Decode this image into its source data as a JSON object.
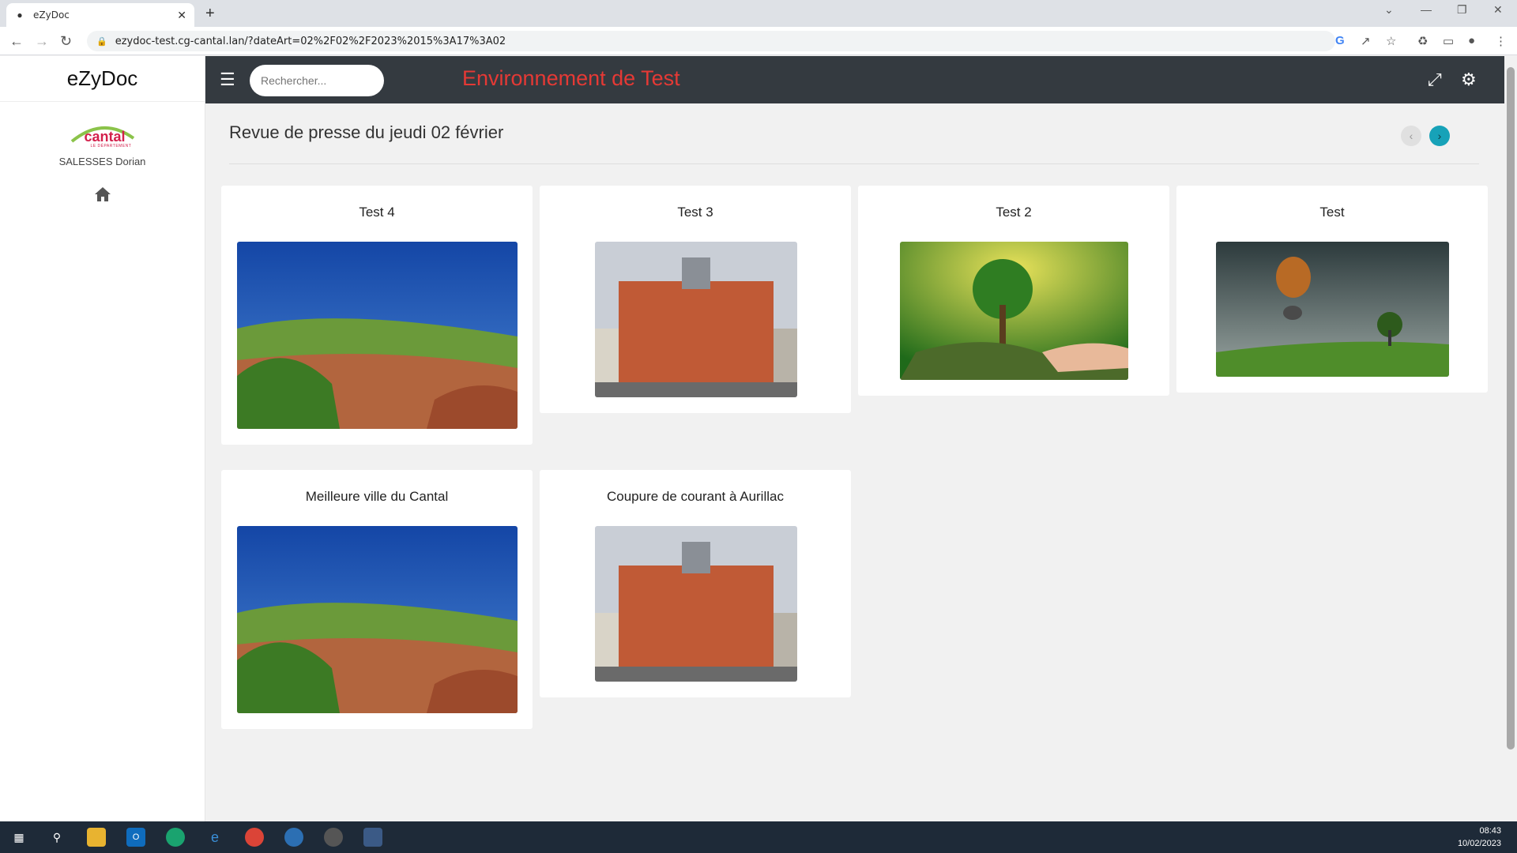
{
  "browser": {
    "tab_title": "eZyDoc",
    "url": "ezydoc-test.cg-cantal.lan/?dateArt=02%2F02%2F2023%2015%3A17%3A02"
  },
  "sidebar": {
    "brand": "eZyDoc",
    "logo_text": "cantal",
    "logo_subtext": "LE DÉPARTEMENT",
    "username": "SALESSES Dorian"
  },
  "topbar": {
    "search_placeholder": "Rechercher...",
    "env_title": "Environnement de Test"
  },
  "main": {
    "page_title": "Revue de presse du jeudi 02 février",
    "cards": [
      {
        "title": "Test 4",
        "image": "landscape-town"
      },
      {
        "title": "Test 3",
        "image": "town-hall"
      },
      {
        "title": "Test 2",
        "image": "tree-in-hand"
      },
      {
        "title": "Test",
        "image": "balloon-elephant"
      },
      {
        "title": "Meilleure ville du Cantal",
        "image": "landscape-town"
      },
      {
        "title": "Coupure de courant à Aurillac",
        "image": "town-hall"
      }
    ]
  },
  "taskbar": {
    "time": "08:43",
    "date": "10/02/2023"
  },
  "colors": {
    "topbar": "#343a40",
    "env_title": "#e53935",
    "accent": "#17a2b8"
  }
}
